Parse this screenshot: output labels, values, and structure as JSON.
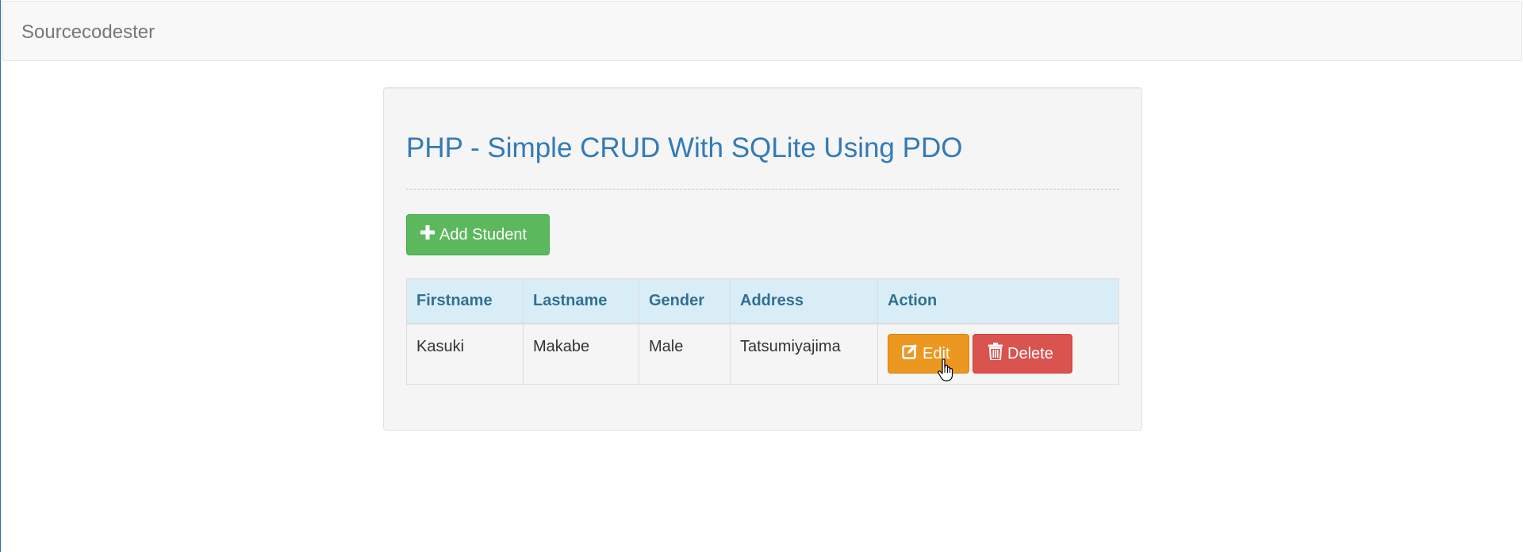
{
  "navbar": {
    "brand": "Sourcecodester"
  },
  "main": {
    "title": "PHP - Simple CRUD With SQLite Using PDO",
    "add_button_label": "Add Student",
    "table": {
      "headers": [
        "Firstname",
        "Lastname",
        "Gender",
        "Address",
        "Action"
      ],
      "rows": [
        {
          "firstname": "Kasuki",
          "lastname": "Makabe",
          "gender": "Male",
          "address": "Tatsumiyajima",
          "edit_label": "Edit",
          "delete_label": "Delete"
        }
      ]
    }
  },
  "colors": {
    "title": "#337ab7",
    "add_button": "#5cb85c",
    "edit_button": "#ec971f",
    "delete_button": "#d9534f",
    "table_header_bg": "#d9edf7",
    "table_header_text": "#31708f"
  },
  "icons": {
    "add": "plus-icon",
    "edit": "edit-icon",
    "delete": "trash-icon",
    "cursor": "hand-pointer-icon"
  }
}
